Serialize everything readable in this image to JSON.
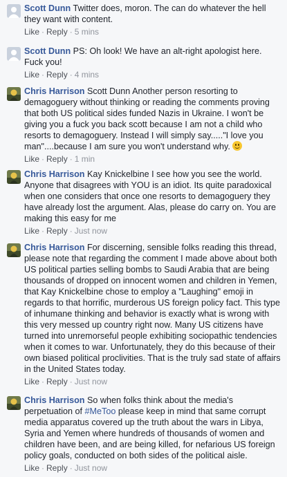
{
  "actions": {
    "like": "Like",
    "reply": "Reply",
    "sep": "·"
  },
  "comments": [
    {
      "author": "Scott Dunn",
      "text": "Twitter does, moron. The can do whatever the hell they want with content.",
      "time": "5 mins",
      "avatar": "silhouette"
    },
    {
      "author": "Scott Dunn",
      "text": "PS: Oh look! We have an alt-right apologist here. Fuck you!",
      "time": "4 mins",
      "avatar": "silhouette"
    },
    {
      "author": "Chris Harrison",
      "text": "Scott Dunn Another person resorting to demagoguery without thinking or reading the comments proving that both US political sides funded Nazis in Ukraine. I won't be giving you a fuck you back scott because I am not a child who resorts to demagoguery. Instead I will simply say.....\"I love you man\"....because I am sure you won't understand why.",
      "time": "1 min",
      "avatar": "photo",
      "emoji": "smiley-face-emoji"
    },
    {
      "author": "Chris Harrison",
      "text": "Kay Knickelbine I see how you see the world. Anyone that disagrees with YOU is an idiot. Its quite paradoxical when one considers that once one resorts to demagoguery they have already lost the argument. Alas, please do carry on. You are making this easy for me",
      "time": "Just now",
      "avatar": "photo"
    },
    {
      "author": "Chris Harrison",
      "text": "For discerning, sensible folks reading this thread, please note that regarding the comment I made above about both US political parties selling bombs to Saudi Arabia that are being thousands of dropped on innocent women and children in Yemen, that Kay Knickelbine chose to employ a \"Laughing\" emoji in regards to that horrific, murderous US foreign policy fact. This type of inhumane thinking and behavior is exactly what is wrong with this very messed up country right now. Many US citizens have turned into unremorseful people exhibiting sociopathic tendencies when it comes to war. Unfortunately, they do this because of their own biased political proclivities. That is the truly sad state of affairs in the United States today.",
      "time": "Just now",
      "avatar": "photo"
    },
    {
      "author": "Chris Harrison",
      "text_before": "So when folks think about the media's perpetuation of",
      "hashtag": "#MeToo",
      "text_after": "please keep in mind that same corrupt media apparatus covered up the truth about the wars in Libya, Syria and Yemen where hundreds of thousands of women and children have been, and are being killed, for nefarious US foreign policy goals, conducted on both sides of the political aisle.",
      "time": "Just now",
      "avatar": "photo"
    }
  ]
}
